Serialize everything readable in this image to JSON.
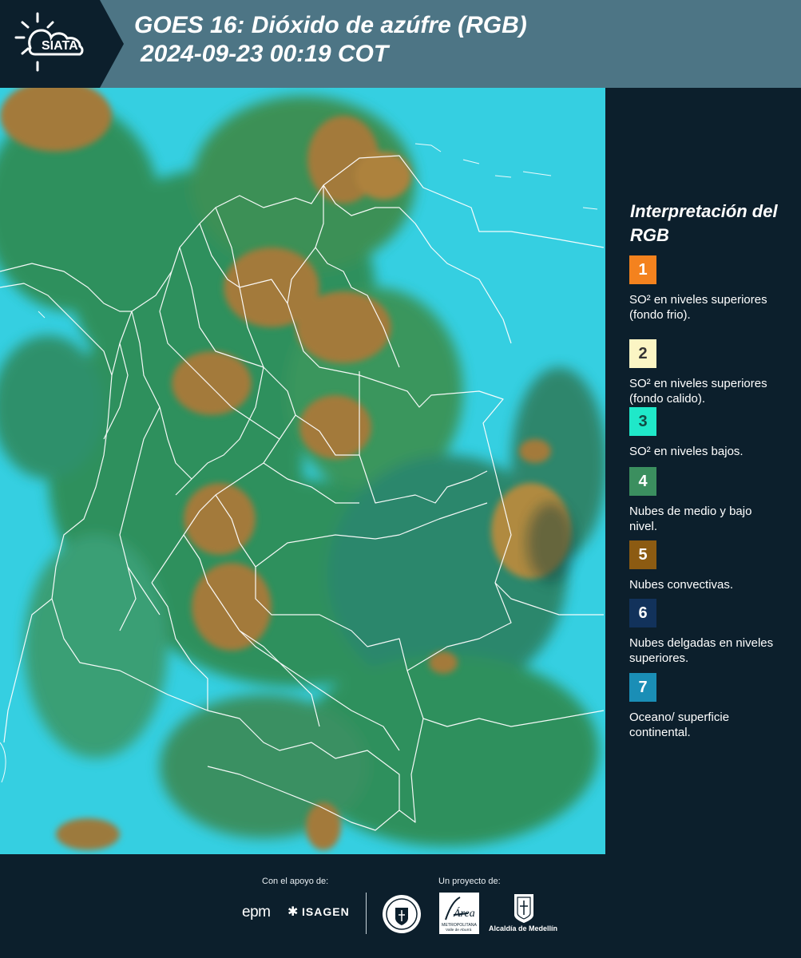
{
  "header": {
    "logo_text": "SIATA",
    "title": "GOES 16: Dióxido de azúfre (RGB)",
    "datetime": "2024-09-23 00:19 COT"
  },
  "legend": {
    "title": "Interpretación del RGB",
    "items": [
      {
        "number": "1",
        "label": "SO² en niveles superiores (fondo frio).",
        "color": "#f4821e",
        "text_color": "#ffffff"
      },
      {
        "number": "2",
        "label": "SO² en niveles superiores (fondo calido).",
        "color": "#fbf5c4",
        "text_color": "#333333"
      },
      {
        "number": "3",
        "label": "SO² en niveles bajos.",
        "color": "#1fe8c9",
        "text_color": "#124a44"
      },
      {
        "number": "4",
        "label": "Nubes de medio y bajo nivel.",
        "color": "#3b8f5f",
        "text_color": "#ffffff"
      },
      {
        "number": "5",
        "label": "Nubes convectivas.",
        "color": "#8c5b12",
        "text_color": "#ffffff"
      },
      {
        "number": "6",
        "label": "Nubes delgadas en niveles superiores.",
        "color": "#12325b",
        "text_color": "#ffffff"
      },
      {
        "number": "7",
        "label": "Oceano/ superficie continental.",
        "color": "#1a8eb6",
        "text_color": "#ffffff"
      }
    ]
  },
  "map": {
    "colors": {
      "ocean": "#35cfe1",
      "low_cloud": "#2f8a4f",
      "convective": "#a37a3a",
      "border": "#ffffff"
    }
  },
  "footer": {
    "support_caption": "Con el apoyo de:",
    "project_caption": "Un proyecto de:",
    "sponsors": [
      "epm",
      "ISAGEN"
    ],
    "area_text": "Área",
    "area_subtext": "METROPOLITANA",
    "area_subtext2": "Valle de Aburrá",
    "alcaldia_text": "Alcaldía de Medellín"
  }
}
